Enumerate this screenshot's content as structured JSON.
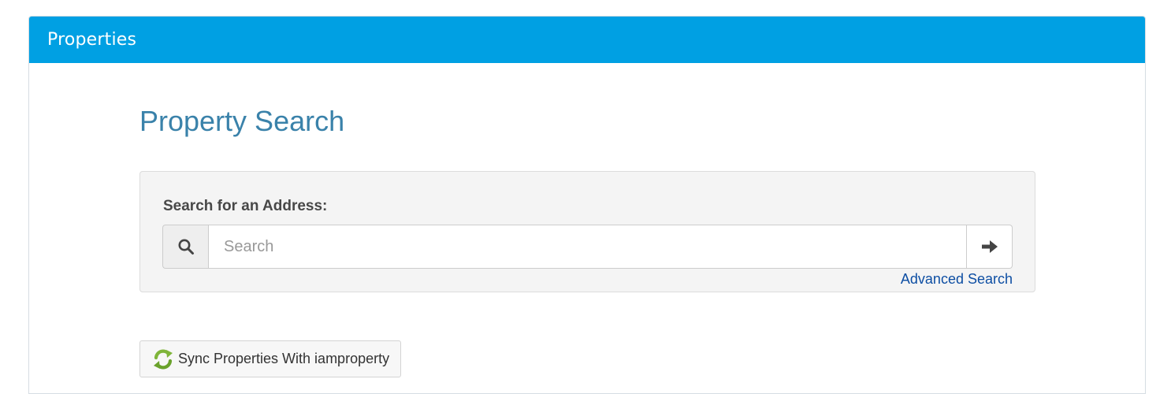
{
  "panel": {
    "title": "Properties"
  },
  "main": {
    "heading": "Property Search",
    "search": {
      "label": "Search for an Address:",
      "placeholder": "Search",
      "value": "",
      "left_icon": "search-icon",
      "submit_icon": "arrow-right-icon",
      "advanced_link": "Advanced Search"
    },
    "sync_button": {
      "label": "Sync Properties With iamproperty",
      "icon": "sync-icon"
    }
  },
  "colors": {
    "header_bg": "#00a0e3",
    "heading_text": "#3a82aa",
    "link": "#0d4ea3",
    "well_bg": "#f4f4f4",
    "sync_icon_green": "#7fb53a"
  }
}
